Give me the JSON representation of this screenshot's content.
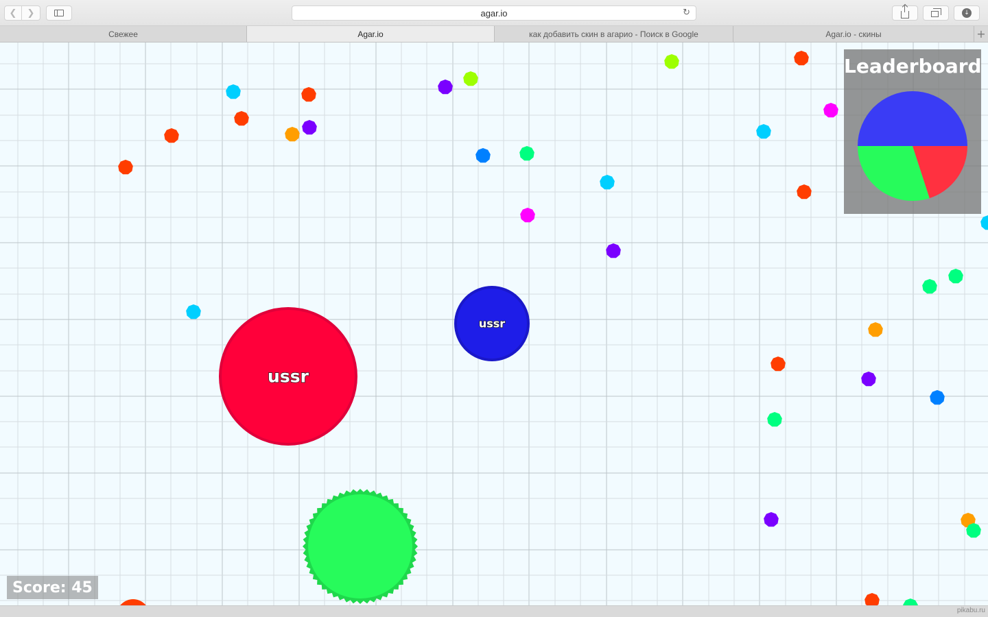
{
  "browser": {
    "address": "agar.io",
    "tabs": [
      {
        "label": "Свежее",
        "active": false
      },
      {
        "label": "Agar.io",
        "active": true
      },
      {
        "label": "как добавить скин в агарио - Поиск в Google",
        "active": false
      },
      {
        "label": "Agar.io - скины",
        "active": false
      }
    ]
  },
  "game": {
    "leaderboard": {
      "title": "Leaderboard",
      "slices": [
        {
          "color": "#3a3cf5",
          "value": 50
        },
        {
          "color": "#ff3140",
          "value": 20
        },
        {
          "color": "#27fb5b",
          "value": 30
        }
      ]
    },
    "score_text": "Score: 45",
    "cells": [
      {
        "name": "ussr",
        "color": "#ff003a",
        "border": "#e0003a"
      },
      {
        "name": "ussr",
        "color": "#1e1de8",
        "border": "#1a18c9"
      },
      {
        "name": "",
        "color": "#27fb5b",
        "border": "#1fd84c"
      }
    ],
    "pellet_colors": [
      "#ff3d00",
      "#00cfff",
      "#ff00ff",
      "#7a00ff",
      "#9dff00",
      "#ff9e00",
      "#00ff80",
      "#0080ff"
    ]
  },
  "watermark": "pikabu.ru"
}
